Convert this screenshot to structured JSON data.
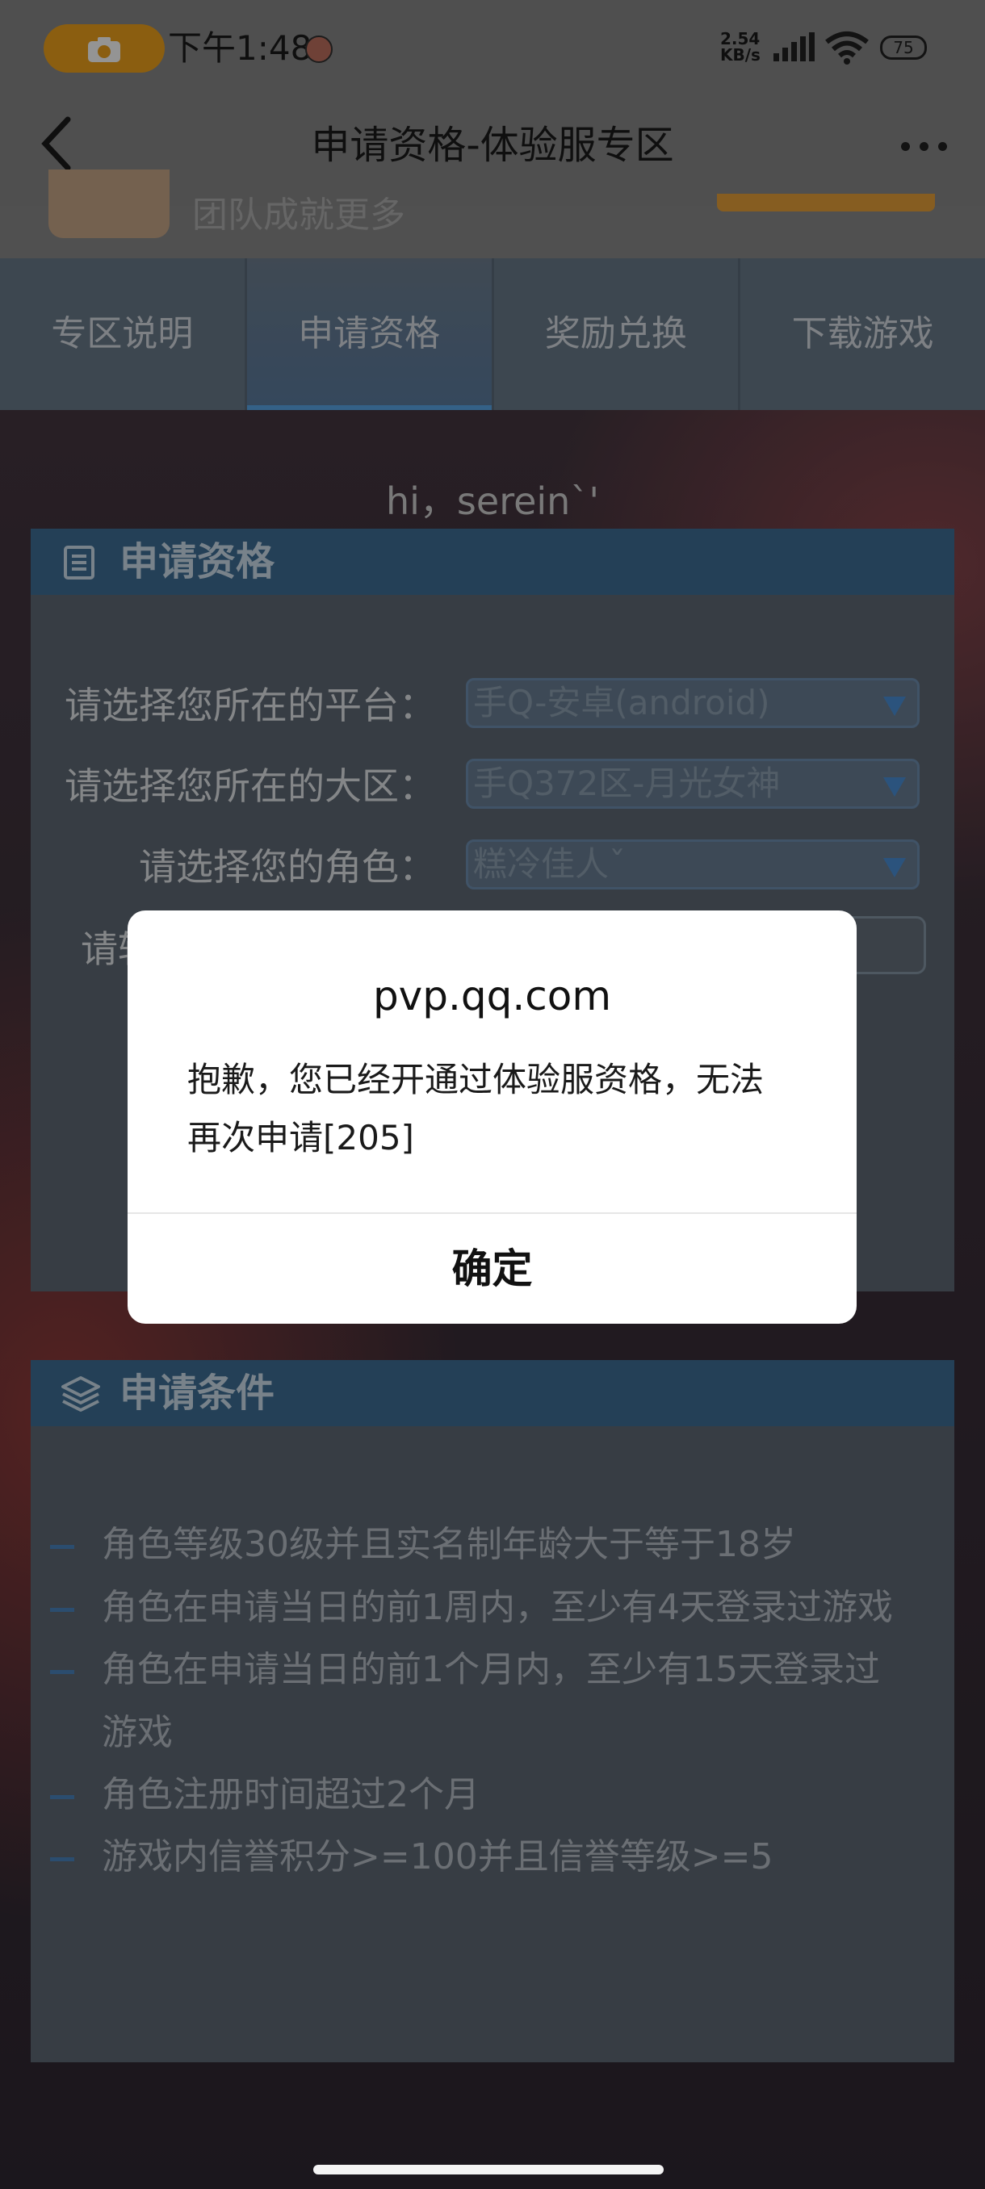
{
  "status_bar": {
    "time": "下午1:48",
    "net_speed_value": "2.54",
    "net_speed_unit": "KB/s",
    "battery": "75",
    "icons": [
      "camera-icon",
      "signal-icon",
      "wifi-icon",
      "battery-icon"
    ]
  },
  "header": {
    "title": "申请资格-体验服专区",
    "back_icon": "chevron-left-icon",
    "more_icon": "more-dots-icon"
  },
  "banner": {
    "text": "团队成就更多"
  },
  "tabs": [
    {
      "label": "专区说明"
    },
    {
      "label": "申请资格",
      "active": true
    },
    {
      "label": "奖励兑换"
    },
    {
      "label": "下载游戏"
    }
  ],
  "greeting": "hi，serein`'",
  "apply_panel": {
    "title": "申请资格",
    "fields": [
      {
        "label": "请选择您所在的平台：",
        "value": "手Q-安卓(android)"
      },
      {
        "label": "请选择您所在的大区：",
        "value": "手Q372区-月光女神"
      },
      {
        "label": "请选择您的角色：",
        "value": "糕冷佳人ˇ"
      },
      {
        "label": "请辅"
      }
    ]
  },
  "conditions_panel": {
    "title": "申请条件",
    "items": [
      "角色等级30级并且实名制年龄大于等于18岁",
      "角色在申请当日的前1周内，至少有4天登录过游戏",
      "角色在申请当日的前1个月内，至少有15天登录过",
      "游戏",
      "角色注册时间超过2个月",
      "游戏内信誉积分>=100并且信誉等级>=5"
    ]
  },
  "dialog": {
    "title": "pvp.qq.com",
    "message_line1": "抱歉，您已经开通过体验服资格，无法",
    "message_line2": "再次申请[205]",
    "confirm_label": "确定"
  },
  "colors": {
    "accent": "#f0a31c",
    "panel_header": "#3f6f97",
    "tab_indicator": "#5aa8e8"
  }
}
